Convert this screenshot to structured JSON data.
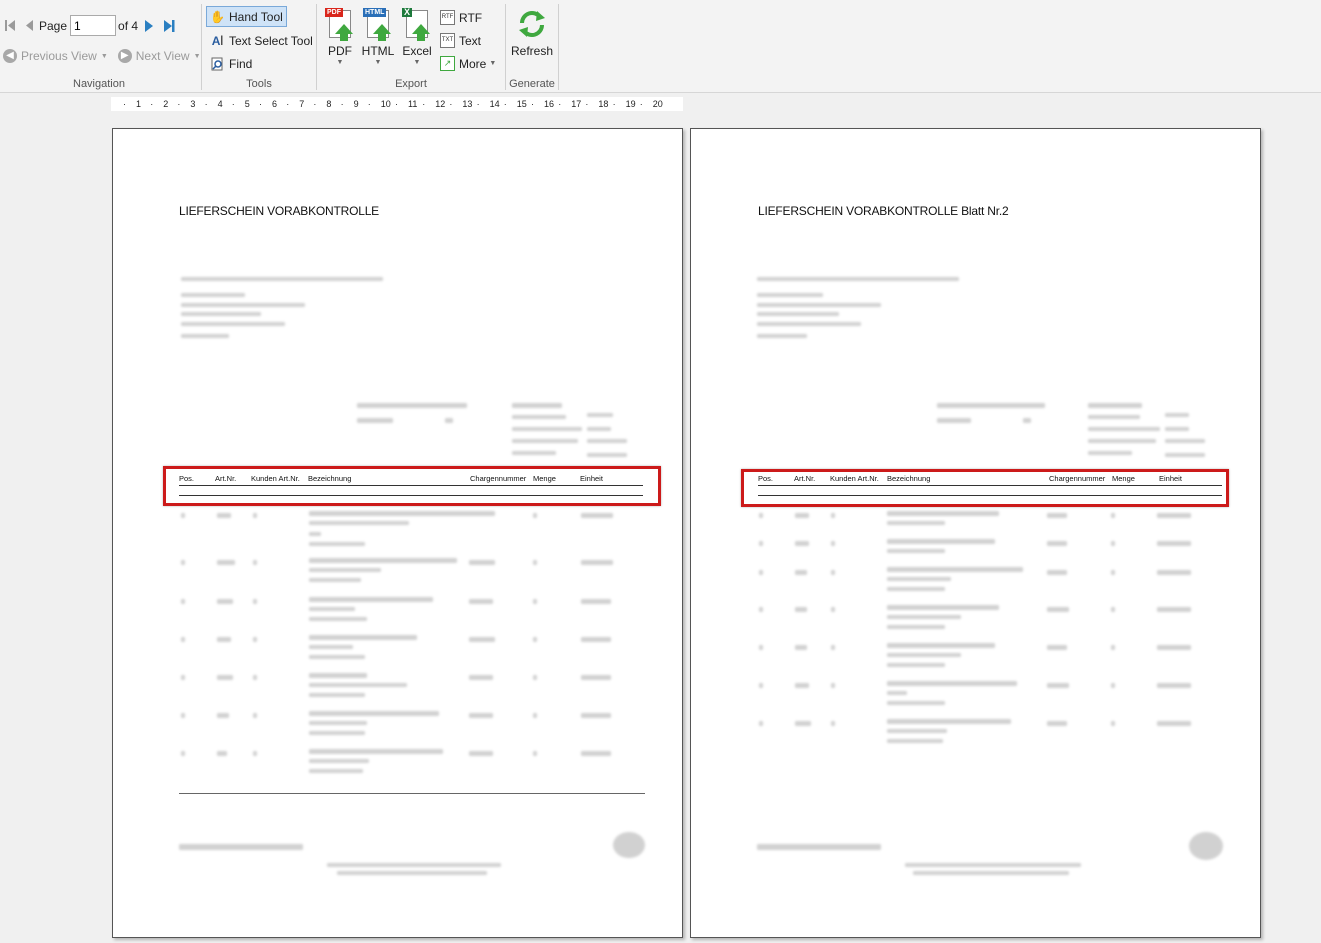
{
  "navigation": {
    "page_label": "Page",
    "page_value": "1",
    "page_of": "of 4",
    "previous_view": "Previous View",
    "next_view": "Next View",
    "group_label": "Navigation"
  },
  "tools": {
    "hand_tool": "Hand Tool",
    "text_select_tool": "Text Select Tool",
    "find": "Find",
    "group_label": "Tools"
  },
  "export": {
    "pdf": "PDF",
    "html": "HTML",
    "excel": "Excel",
    "rtf": "RTF",
    "text": "Text",
    "more": "More",
    "group_label": "Export"
  },
  "generate": {
    "refresh": "Refresh",
    "group_label": "Generate"
  },
  "ruler": [
    "1",
    "2",
    "3",
    "4",
    "5",
    "6",
    "7",
    "8",
    "9",
    "10",
    "11",
    "12",
    "13",
    "14",
    "15",
    "16",
    "17",
    "18",
    "19",
    "20"
  ],
  "pages": [
    {
      "title": "LIEFERSCHEIN VORABKONTROLLE",
      "columns": [
        "Pos.",
        "Art.Nr.",
        "Kunden Art.Nr.",
        "Bezeichnung",
        "Chargennummer",
        "Menge",
        "Einheit"
      ]
    },
    {
      "title": "LIEFERSCHEIN VORABKONTROLLE Blatt Nr.2",
      "columns": [
        "Pos.",
        "Art.Nr.",
        "Kunden Art.Nr.",
        "Bezeichnung",
        "Chargennummer",
        "Menge",
        "Einheit"
      ]
    }
  ],
  "colors": {
    "highlight": "#cc1a1a",
    "active_tool": "#cfe3f7",
    "nav_icon": "#2a7fc1"
  }
}
